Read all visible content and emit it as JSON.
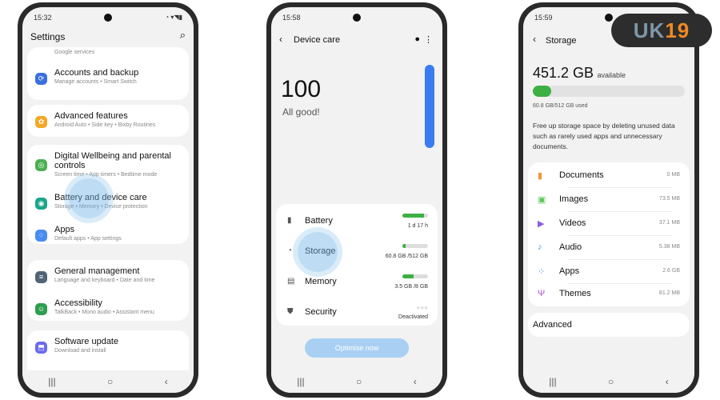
{
  "phone1": {
    "time": "15:32",
    "status_icons": "◔ ▾◥▮",
    "title": "Settings",
    "items": [
      {
        "title": "",
        "sub": "Google services",
        "color": "#3b6fe0",
        "icon": "google-icon"
      },
      {
        "title": "Accounts and backup",
        "sub": "Manage accounts  •  Smart Switch",
        "color": "#3b6fe0",
        "icon": "sync-icon"
      },
      {
        "title": "Advanced features",
        "sub": "Android Auto  •  Side key  •  Bixby Routines",
        "color": "#f5a623",
        "icon": "gear-plus-icon"
      },
      {
        "title": "Digital Wellbeing and parental controls",
        "sub": "Screen time  •  App timers  •  Bedtime mode",
        "color": "#4caf50",
        "icon": "wellbeing-icon"
      },
      {
        "title": "Battery and device care",
        "sub": "Storage  •  Memory  •  Device protection",
        "color": "#1aa68a",
        "icon": "device-care-icon"
      },
      {
        "title": "Apps",
        "sub": "Default apps  •  App settings",
        "color": "#4a8cf0",
        "icon": "apps-icon"
      },
      {
        "title": "General management",
        "sub": "Language and keyboard  •  Date and time",
        "color": "#4f6477",
        "icon": "sliders-icon"
      },
      {
        "title": "Accessibility",
        "sub": "TalkBack  •  Mono audio  •  Assistant menu",
        "color": "#2e9e4f",
        "icon": "accessibility-icon"
      },
      {
        "title": "Software update",
        "sub": "Download and install",
        "color": "#6a6af0",
        "icon": "update-icon"
      }
    ]
  },
  "phone2": {
    "time": "15:58",
    "title": "Device care",
    "score": "100",
    "score_text": "All good!",
    "rows": [
      {
        "label": "Battery",
        "value": "1 d 17 h",
        "fill": 0.85
      },
      {
        "label": "Storage",
        "value": "60.8 GB /512 GB",
        "fill": 0.12
      },
      {
        "label": "Memory",
        "value": "3.5 GB /8 GB",
        "fill": 0.44
      },
      {
        "label": "Security",
        "value": "Deactivated",
        "fill": 0
      }
    ],
    "button": "Optimise now"
  },
  "phone3": {
    "time": "15:59",
    "title": "Storage",
    "available": "451.2 GB",
    "available_label": "available",
    "used_fraction": 0.119,
    "used_text": "60.8 GB/512 GB used",
    "description": "Free up storage space by deleting unused data such as rarely used apps and unnecessary documents.",
    "categories": [
      {
        "label": "Documents",
        "value": "0 MB",
        "color": "#f5943a",
        "glyph": "▮"
      },
      {
        "label": "Images",
        "value": "73.5 MB",
        "color": "#5cc85c",
        "glyph": "▣"
      },
      {
        "label": "Videos",
        "value": "37.1 MB",
        "color": "#8c5ce0",
        "glyph": "▶"
      },
      {
        "label": "Audio",
        "value": "5.38 MB",
        "color": "#3c9be8",
        "glyph": "♪"
      },
      {
        "label": "Apps",
        "value": "2.6 GB",
        "color": "#4a8cf0",
        "glyph": "⁘"
      },
      {
        "label": "Themes",
        "value": "81.2 MB",
        "color": "#b052d6",
        "glyph": "Ψ"
      }
    ],
    "advanced": "Advanced"
  },
  "watermark": "UK19"
}
